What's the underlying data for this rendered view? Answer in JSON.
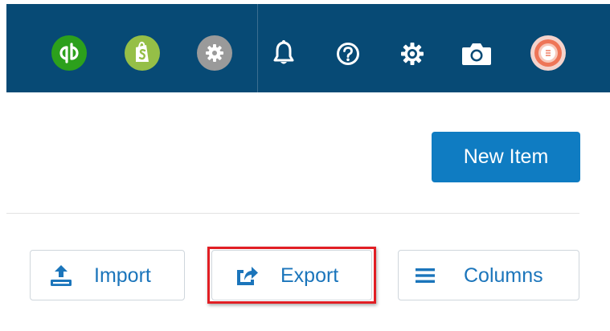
{
  "topbar": {
    "apps": [
      {
        "name": "quickbooks",
        "icon": "quickbooks-icon",
        "color": "#2ca01c"
      },
      {
        "name": "shopify",
        "icon": "shopify-icon",
        "color": "#95bf47"
      },
      {
        "name": "app-settings",
        "icon": "gear-icon",
        "color": "#9a9a9a"
      }
    ],
    "actions": [
      "bell-icon",
      "help-icon",
      "settings-gear-icon",
      "camera-icon",
      "avatar"
    ],
    "background": "#074a75"
  },
  "header": {
    "new_item_label": "New Item",
    "new_item_color": "#0f7cc2"
  },
  "toolbar": {
    "import_label": "Import",
    "export_label": "Export",
    "columns_label": "Columns",
    "label_color": "#1b75bb",
    "highlight_color": "#e11e24"
  }
}
